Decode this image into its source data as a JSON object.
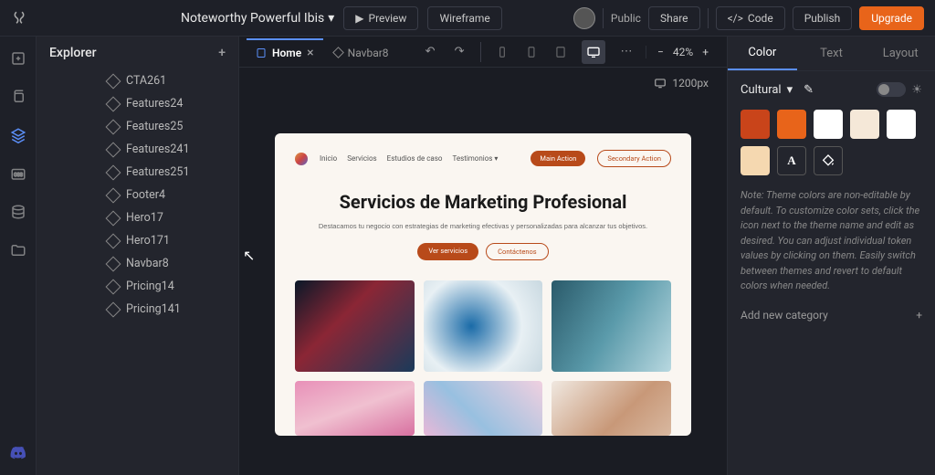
{
  "project_name": "Noteworthy Powerful Ibis",
  "topbar": {
    "preview": "Preview",
    "wireframe": "Wireframe",
    "public": "Public",
    "share": "Share",
    "code": "Code",
    "publish": "Publish",
    "upgrade": "Upgrade"
  },
  "explorer": {
    "title": "Explorer",
    "items": [
      "CTA261",
      "Features24",
      "Features25",
      "Features241",
      "Features251",
      "Footer4",
      "Hero17",
      "Hero171",
      "Navbar8",
      "Pricing14",
      "Pricing141"
    ]
  },
  "tabs": [
    {
      "label": "Home",
      "active": true,
      "closable": true
    },
    {
      "label": "Navbar8",
      "active": false,
      "closable": false
    }
  ],
  "zoom": "42%",
  "breakpoint": "1200px",
  "artboard": {
    "nav": [
      "Inicio",
      "Servicios",
      "Estudios de caso",
      "Testimonios"
    ],
    "nav_cta1": "Main Action",
    "nav_cta2": "Secondary Action",
    "h1": "Servicios de Marketing Profesional",
    "sub": "Destacamos tu negocio con estrategias de marketing efectivas y personalizadas para alcanzar tus objetivos.",
    "btn1": "Ver servicios",
    "btn2": "Contáctenos"
  },
  "right": {
    "tabs": [
      "Color",
      "Text",
      "Layout"
    ],
    "theme": "Cultural",
    "swatches": [
      "#c9441a",
      "#e8641a",
      "#ffffff",
      "#f5e8d8",
      "#ffffff",
      "#f5d8b0"
    ],
    "note": "Note: Theme colors are non-editable by default. To customize color sets, click the icon next to the theme name and edit as desired. You can adjust individual token values by clicking on them. Easily switch between themes and revert to default colors when needed.",
    "add_cat": "Add new category"
  }
}
